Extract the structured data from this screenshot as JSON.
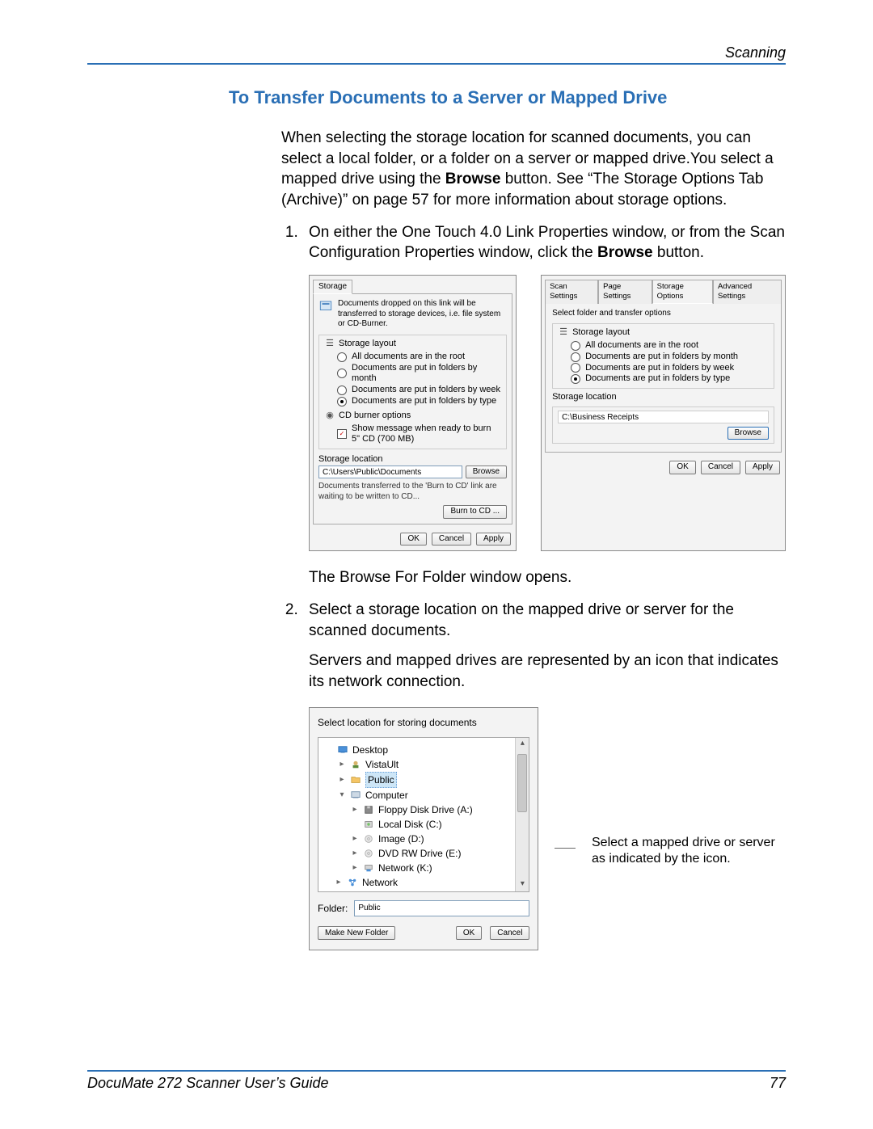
{
  "header": {
    "right": "Scanning"
  },
  "section_title": "To Transfer Documents to a Server or Mapped Drive",
  "para1_a": "When selecting the storage location for scanned documents, you can select a local folder, or a folder on a server or mapped drive.You select a mapped drive using the ",
  "para1_b": "Browse",
  "para1_c": " button. See “The Storage Options Tab (Archive)” on page 57 for more information about storage options.",
  "step1_a": "On either the One Touch 4.0 Link Properties window, or from the Scan Configuration Properties window, click the ",
  "step1_b": "Browse",
  "step1_c": " button.",
  "dlg1": {
    "tab": "Storage",
    "desc": "Documents dropped on this link will be transferred to storage devices, i.e. file system or CD-Burner.",
    "layout_title": "Storage layout",
    "r1": "All documents are in the root",
    "r2": "Documents are put in folders by month",
    "r3": "Documents are put in folders by week",
    "r4": "Documents are put in folders by type",
    "cd_title": "CD burner options",
    "cd_check": "Show message when ready to burn 5\" CD (700 MB)",
    "loc_label": "Storage location",
    "loc_value": "C:\\Users\\Public\\Documents",
    "browse": "Browse",
    "transfer_note": "Documents transferred to the 'Burn to CD' link are waiting to be written to CD...",
    "burn": "Burn to CD ...",
    "ok": "OK",
    "cancel": "Cancel",
    "apply": "Apply"
  },
  "dlg2": {
    "tabs": [
      "Scan Settings",
      "Page Settings",
      "Storage Options",
      "Advanced Settings"
    ],
    "topline": "Select folder and transfer options",
    "layout_title": "Storage layout",
    "r1": "All documents are in the root",
    "r2": "Documents are put in folders by month",
    "r3": "Documents are put in folders by week",
    "r4": "Documents are put in folders by type",
    "loc_label": "Storage location",
    "loc_value": "C:\\Business Receipts",
    "browse": "Browse",
    "ok": "OK",
    "cancel": "Cancel",
    "apply": "Apply"
  },
  "after_dialogs": "The Browse For Folder window opens.",
  "step2": "Select a storage location on the mapped drive or server for the scanned documents.",
  "step2_b": "Servers and mapped drives are represented by an icon that indicates its network connection.",
  "bfolder": {
    "title": "Select location for storing documents",
    "items": [
      {
        "indent": 0,
        "tri": "none",
        "icon": "desktop",
        "label": "Desktop"
      },
      {
        "indent": 1,
        "tri": "right",
        "icon": "user",
        "label": "VistaUlt"
      },
      {
        "indent": 1,
        "tri": "right",
        "icon": "folder",
        "label": "Public",
        "selected": true
      },
      {
        "indent": 1,
        "tri": "down",
        "icon": "computer",
        "label": "Computer"
      },
      {
        "indent": 2,
        "tri": "right",
        "icon": "floppy",
        "label": "Floppy Disk Drive (A:)"
      },
      {
        "indent": 2,
        "tri": "none",
        "icon": "disk",
        "label": "Local Disk (C:)"
      },
      {
        "indent": 2,
        "tri": "right",
        "icon": "disc",
        "label": "Image (D:)"
      },
      {
        "indent": 2,
        "tri": "right",
        "icon": "disc",
        "label": "DVD RW Drive (E:)"
      },
      {
        "indent": 2,
        "tri": "right",
        "icon": "netdrive",
        "label": "Network (K:)"
      },
      {
        "indent": 1,
        "tri": "right",
        "icon": "network",
        "label": "Network",
        "cut": true
      }
    ],
    "folder_label": "Folder:",
    "folder_value": "Public",
    "make_new": "Make New Folder",
    "ok": "OK",
    "cancel": "Cancel"
  },
  "callout": "Select a mapped drive or server as indicated by the icon.",
  "footer": {
    "left": "DocuMate 272 Scanner User’s Guide",
    "right": "77"
  }
}
